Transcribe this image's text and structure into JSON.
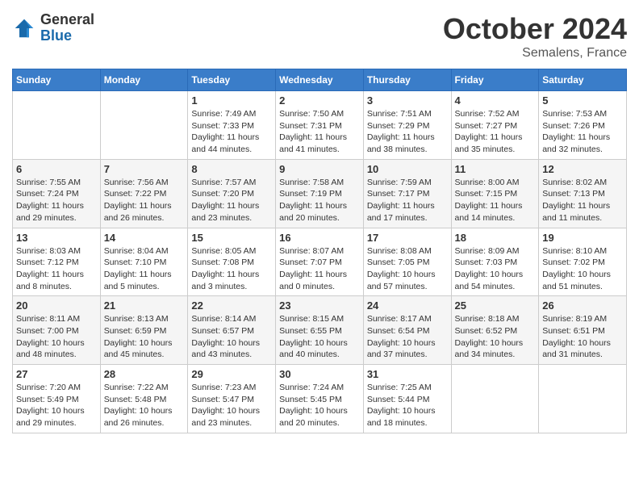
{
  "header": {
    "logo": {
      "general": "General",
      "blue": "Blue"
    },
    "title": "October 2024",
    "location": "Semalens, France"
  },
  "weekdays": [
    "Sunday",
    "Monday",
    "Tuesday",
    "Wednesday",
    "Thursday",
    "Friday",
    "Saturday"
  ],
  "weeks": [
    [
      {
        "day": "",
        "info": ""
      },
      {
        "day": "",
        "info": ""
      },
      {
        "day": "1",
        "info": "Sunrise: 7:49 AM\nSunset: 7:33 PM\nDaylight: 11 hours and 44 minutes."
      },
      {
        "day": "2",
        "info": "Sunrise: 7:50 AM\nSunset: 7:31 PM\nDaylight: 11 hours and 41 minutes."
      },
      {
        "day": "3",
        "info": "Sunrise: 7:51 AM\nSunset: 7:29 PM\nDaylight: 11 hours and 38 minutes."
      },
      {
        "day": "4",
        "info": "Sunrise: 7:52 AM\nSunset: 7:27 PM\nDaylight: 11 hours and 35 minutes."
      },
      {
        "day": "5",
        "info": "Sunrise: 7:53 AM\nSunset: 7:26 PM\nDaylight: 11 hours and 32 minutes."
      }
    ],
    [
      {
        "day": "6",
        "info": "Sunrise: 7:55 AM\nSunset: 7:24 PM\nDaylight: 11 hours and 29 minutes."
      },
      {
        "day": "7",
        "info": "Sunrise: 7:56 AM\nSunset: 7:22 PM\nDaylight: 11 hours and 26 minutes."
      },
      {
        "day": "8",
        "info": "Sunrise: 7:57 AM\nSunset: 7:20 PM\nDaylight: 11 hours and 23 minutes."
      },
      {
        "day": "9",
        "info": "Sunrise: 7:58 AM\nSunset: 7:19 PM\nDaylight: 11 hours and 20 minutes."
      },
      {
        "day": "10",
        "info": "Sunrise: 7:59 AM\nSunset: 7:17 PM\nDaylight: 11 hours and 17 minutes."
      },
      {
        "day": "11",
        "info": "Sunrise: 8:00 AM\nSunset: 7:15 PM\nDaylight: 11 hours and 14 minutes."
      },
      {
        "day": "12",
        "info": "Sunrise: 8:02 AM\nSunset: 7:13 PM\nDaylight: 11 hours and 11 minutes."
      }
    ],
    [
      {
        "day": "13",
        "info": "Sunrise: 8:03 AM\nSunset: 7:12 PM\nDaylight: 11 hours and 8 minutes."
      },
      {
        "day": "14",
        "info": "Sunrise: 8:04 AM\nSunset: 7:10 PM\nDaylight: 11 hours and 5 minutes."
      },
      {
        "day": "15",
        "info": "Sunrise: 8:05 AM\nSunset: 7:08 PM\nDaylight: 11 hours and 3 minutes."
      },
      {
        "day": "16",
        "info": "Sunrise: 8:07 AM\nSunset: 7:07 PM\nDaylight: 11 hours and 0 minutes."
      },
      {
        "day": "17",
        "info": "Sunrise: 8:08 AM\nSunset: 7:05 PM\nDaylight: 10 hours and 57 minutes."
      },
      {
        "day": "18",
        "info": "Sunrise: 8:09 AM\nSunset: 7:03 PM\nDaylight: 10 hours and 54 minutes."
      },
      {
        "day": "19",
        "info": "Sunrise: 8:10 AM\nSunset: 7:02 PM\nDaylight: 10 hours and 51 minutes."
      }
    ],
    [
      {
        "day": "20",
        "info": "Sunrise: 8:11 AM\nSunset: 7:00 PM\nDaylight: 10 hours and 48 minutes."
      },
      {
        "day": "21",
        "info": "Sunrise: 8:13 AM\nSunset: 6:59 PM\nDaylight: 10 hours and 45 minutes."
      },
      {
        "day": "22",
        "info": "Sunrise: 8:14 AM\nSunset: 6:57 PM\nDaylight: 10 hours and 43 minutes."
      },
      {
        "day": "23",
        "info": "Sunrise: 8:15 AM\nSunset: 6:55 PM\nDaylight: 10 hours and 40 minutes."
      },
      {
        "day": "24",
        "info": "Sunrise: 8:17 AM\nSunset: 6:54 PM\nDaylight: 10 hours and 37 minutes."
      },
      {
        "day": "25",
        "info": "Sunrise: 8:18 AM\nSunset: 6:52 PM\nDaylight: 10 hours and 34 minutes."
      },
      {
        "day": "26",
        "info": "Sunrise: 8:19 AM\nSunset: 6:51 PM\nDaylight: 10 hours and 31 minutes."
      }
    ],
    [
      {
        "day": "27",
        "info": "Sunrise: 7:20 AM\nSunset: 5:49 PM\nDaylight: 10 hours and 29 minutes."
      },
      {
        "day": "28",
        "info": "Sunrise: 7:22 AM\nSunset: 5:48 PM\nDaylight: 10 hours and 26 minutes."
      },
      {
        "day": "29",
        "info": "Sunrise: 7:23 AM\nSunset: 5:47 PM\nDaylight: 10 hours and 23 minutes."
      },
      {
        "day": "30",
        "info": "Sunrise: 7:24 AM\nSunset: 5:45 PM\nDaylight: 10 hours and 20 minutes."
      },
      {
        "day": "31",
        "info": "Sunrise: 7:25 AM\nSunset: 5:44 PM\nDaylight: 10 hours and 18 minutes."
      },
      {
        "day": "",
        "info": ""
      },
      {
        "day": "",
        "info": ""
      }
    ]
  ]
}
